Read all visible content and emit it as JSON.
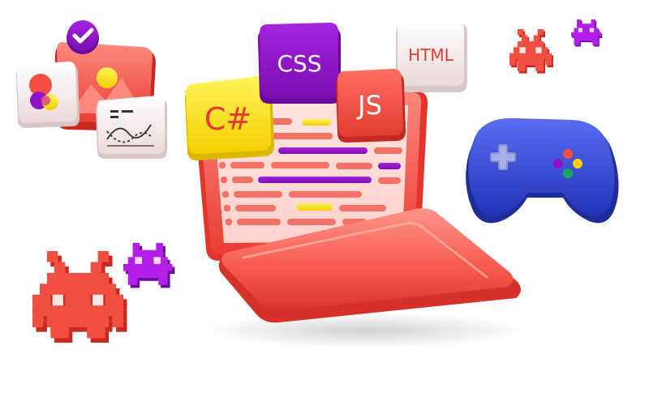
{
  "language_tiles": {
    "csharp": "C#",
    "css": "CSS",
    "js": "JS",
    "html": "HTML"
  },
  "colors": {
    "coral": "#f24f43",
    "coral_light": "#ff7a6e",
    "purple": "#8e12c7",
    "violet": "#b31ee8",
    "yellow": "#ffe92e",
    "blue": "#3b4fd1",
    "white_tile": "#f6ecec"
  },
  "icons": [
    "checkmark-icon",
    "image-gallery-icon",
    "color-circles-icon",
    "chart-card-icon",
    "gamepad-icon",
    "pixel-invader-icon"
  ]
}
